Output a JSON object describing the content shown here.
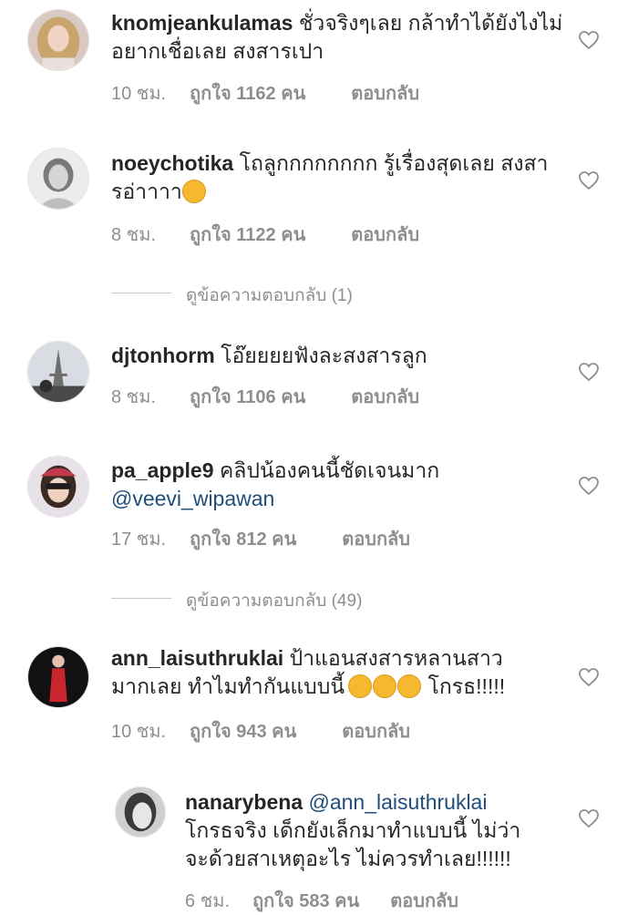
{
  "comments": [
    {
      "username": "knomjeankulamas",
      "text": "ชั่วจริงๆเลย กล้าทำได้ยังไงไม่อยากเชื่อเลย สงสารเปา",
      "time": "10 ชม.",
      "likes": "ถูกใจ 1162 คน",
      "reply": "ตอบกลับ",
      "avatar_icon": "profile-photo-woman-blonde"
    },
    {
      "username": "noeychotika",
      "text": "โถลูกกกกกกกก รู้เรื่องสุดเลย สงสารอ่าาาา",
      "emoji": "crying-face-emoji",
      "time": "8 ชม.",
      "likes": "ถูกใจ 1122 คน",
      "reply": "ตอบกลับ",
      "view_replies": "ดูข้อความตอบกลับ (1)",
      "avatar_icon": "profile-photo-woman-bw"
    },
    {
      "username": "djtonhorm",
      "text": "โอ๊ยยยยฟังละสงสารลูก",
      "time": "8 ชม.",
      "likes": "ถูกใจ 1106 คน",
      "reply": "ตอบกลับ",
      "avatar_icon": "profile-photo-eiffel-tower"
    },
    {
      "username": "pa_apple9",
      "text": "คลิปน้องคนนี้ชัดเจนมาก",
      "mention": "@veevi_wipawan",
      "time": "17 ชม.",
      "likes": "ถูกใจ 812 คน",
      "reply": "ตอบกลับ",
      "view_replies": "ดูข้อความตอบกลับ (49)",
      "avatar_icon": "profile-photo-woman-sunglasses"
    },
    {
      "username": "ann_laisuthruklai",
      "text_line1": "ป้าแอนสงสารหลานสาว",
      "text_line2": "มากเลย ทำไมทำกันแบบนี้",
      "text_after": " โกรธ!!!!!",
      "emoji": "angry-face-emoji",
      "time": "10 ชม.",
      "likes": "ถูกใจ 943 คน",
      "reply": "ตอบกลับ",
      "avatar_icon": "profile-photo-woman-red-dress"
    }
  ],
  "reply": {
    "username": "nanarybena",
    "mention": "@ann_laisuthruklai",
    "text_line2": "โกรธจริง เด็กยังเล็กมาทำแบบนี้ ไม่ว่า",
    "text_line3": "จะด้วยสาเหตุอะไร ไม่ควรทำเลย!!!!!!",
    "time": "6 ชม.",
    "likes": "ถูกใจ 583 คน",
    "reply": "ตอบกลับ",
    "avatar_icon": "profile-photo-woman-bw-closeup"
  },
  "icons": {
    "like": "heart-outline-icon"
  },
  "colors": {
    "mention": "#1f4d7a",
    "meta": "#8e8e8e",
    "text": "#262626"
  }
}
